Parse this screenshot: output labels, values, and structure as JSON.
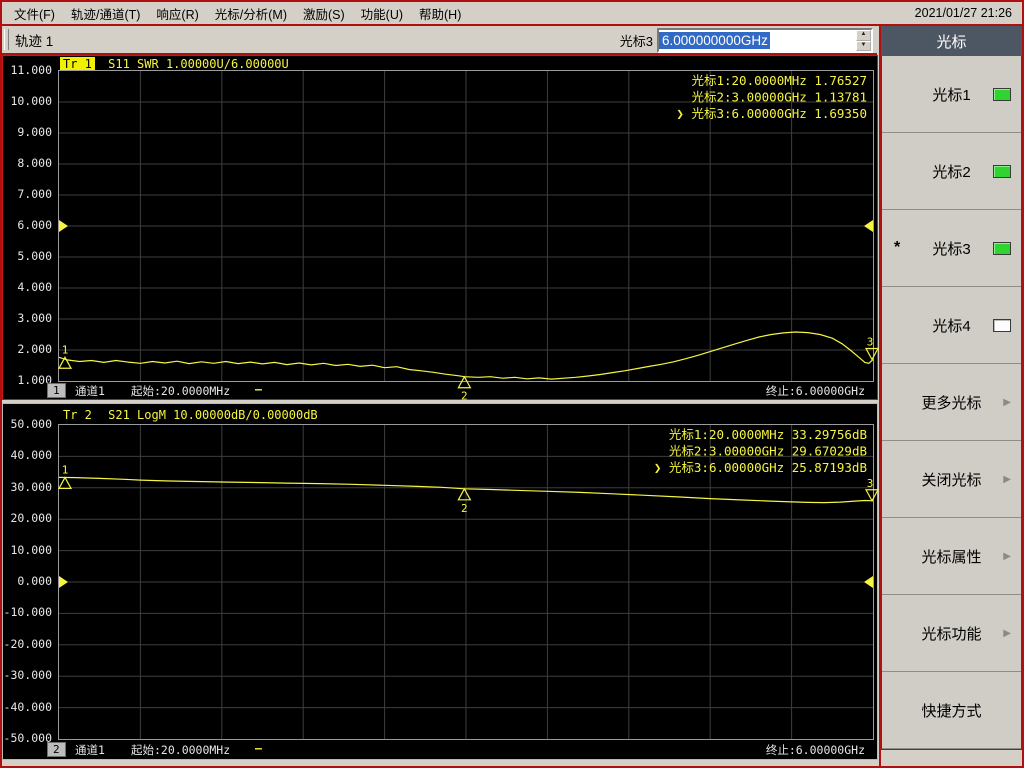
{
  "titlebar": {
    "menus": [
      {
        "id": "file",
        "label": "文件(F)"
      },
      {
        "id": "trace-channel",
        "label": "轨迹/通道(T)"
      },
      {
        "id": "response",
        "label": "响应(R)"
      },
      {
        "id": "marker-analysis",
        "label": "光标/分析(M)"
      },
      {
        "id": "stimulus",
        "label": "激励(S)"
      },
      {
        "id": "function",
        "label": "功能(U)"
      },
      {
        "id": "help",
        "label": "帮助(H)"
      }
    ],
    "datetime": "2021/01/27 21:26"
  },
  "toolbar": {
    "trace_label": "轨迹 1",
    "marker_name": "光标3",
    "marker_value": "6.000000000GHz"
  },
  "sidebar": {
    "title": "光标",
    "active_indicator": "*",
    "buttons": [
      {
        "id": "marker1",
        "label": "光标1",
        "led": "on",
        "active": false
      },
      {
        "id": "marker2",
        "label": "光标2",
        "led": "on",
        "active": false
      },
      {
        "id": "marker3",
        "label": "光标3",
        "led": "on",
        "active": true
      },
      {
        "id": "marker4",
        "label": "光标4",
        "led": "off",
        "active": false
      },
      {
        "id": "more-markers",
        "label": "更多光标",
        "arrow": true
      },
      {
        "id": "close-markers",
        "label": "关闭光标",
        "arrow": true
      },
      {
        "id": "marker-properties",
        "label": "光标属性",
        "arrow": true
      },
      {
        "id": "marker-functions",
        "label": "光标功能",
        "arrow": true
      },
      {
        "id": "shortcuts",
        "label": "快捷方式"
      }
    ]
  },
  "ui": {
    "active_prefix": "❯",
    "dash": "—"
  },
  "colors": {
    "trace": "#f5f542",
    "readout": "#f5f542",
    "grid": "#3e3e3e",
    "plot_border": "#9b9b9b",
    "led_on": "#2fd42f",
    "selection_blue": "#316ac5",
    "frame_red": "#b01010",
    "panel_header": "#4d5663"
  },
  "charts": [
    {
      "trace_badge": "Tr 1",
      "trace_active": true,
      "trace_info": "S11 SWR 1.00000U/6.00000U",
      "marker_readouts": [
        {
          "name": "光标1",
          "freq": "20.0000MHz",
          "value": "1.76527",
          "active": false
        },
        {
          "name": "光标2",
          "freq": "3.00000GHz",
          "value": "1.13781",
          "active": false
        },
        {
          "name": "光标3",
          "freq": "6.00000GHz",
          "value": "1.69350",
          "active": true
        }
      ],
      "channel_badge": "1",
      "channel": "通道1",
      "start": "起始:20.0000MHz",
      "dash": "—",
      "stop": "终止:6.00000GHz"
    },
    {
      "trace_badge": "Tr 2",
      "trace_active": false,
      "trace_info": "S21 LogM 10.00000dB/0.00000dB",
      "marker_readouts": [
        {
          "name": "光标1",
          "freq": "20.0000MHz",
          "value": "33.29756dB",
          "active": false
        },
        {
          "name": "光标2",
          "freq": "3.00000GHz",
          "value": "29.67029dB",
          "active": false
        },
        {
          "name": "光标3",
          "freq": "6.00000GHz",
          "value": "25.87193dB",
          "active": true
        }
      ],
      "channel_badge": "2",
      "channel": "通道1",
      "start": "起始:20.0000MHz",
      "dash": "—",
      "stop": "终止:6.00000GHz"
    }
  ],
  "chart_data": [
    {
      "type": "line",
      "title": "S11 SWR",
      "x_start": "20.0000MHz",
      "x_stop": "6.00000GHz",
      "ylim": [
        1,
        11
      ],
      "ystep": 1,
      "ref_value": 6.0,
      "grid": [
        10,
        10
      ],
      "series": [
        {
          "name": "S11 SWR",
          "points": [
            [
              0,
              1.765
            ],
            [
              0.01,
              1.68
            ],
            [
              0.025,
              1.63
            ],
            [
              0.04,
              1.66
            ],
            [
              0.055,
              1.6
            ],
            [
              0.07,
              1.66
            ],
            [
              0.085,
              1.61
            ],
            [
              0.1,
              1.57
            ],
            [
              0.115,
              1.63
            ],
            [
              0.13,
              1.58
            ],
            [
              0.145,
              1.64
            ],
            [
              0.16,
              1.56
            ],
            [
              0.175,
              1.62
            ],
            [
              0.19,
              1.57
            ],
            [
              0.205,
              1.63
            ],
            [
              0.22,
              1.56
            ],
            [
              0.235,
              1.61
            ],
            [
              0.25,
              1.55
            ],
            [
              0.265,
              1.6
            ],
            [
              0.28,
              1.53
            ],
            [
              0.295,
              1.58
            ],
            [
              0.31,
              1.52
            ],
            [
              0.325,
              1.57
            ],
            [
              0.34,
              1.5
            ],
            [
              0.355,
              1.54
            ],
            [
              0.37,
              1.47
            ],
            [
              0.385,
              1.51
            ],
            [
              0.4,
              1.43
            ],
            [
              0.415,
              1.46
            ],
            [
              0.43,
              1.37
            ],
            [
              0.445,
              1.33
            ],
            [
              0.46,
              1.28
            ],
            [
              0.475,
              1.22
            ],
            [
              0.49,
              1.17
            ],
            [
              0.498,
              1.138
            ],
            [
              0.515,
              1.12
            ],
            [
              0.53,
              1.14
            ],
            [
              0.545,
              1.09
            ],
            [
              0.56,
              1.12
            ],
            [
              0.575,
              1.07
            ],
            [
              0.59,
              1.1
            ],
            [
              0.605,
              1.06
            ],
            [
              0.62,
              1.09
            ],
            [
              0.635,
              1.12
            ],
            [
              0.65,
              1.16
            ],
            [
              0.665,
              1.21
            ],
            [
              0.68,
              1.27
            ],
            [
              0.695,
              1.33
            ],
            [
              0.71,
              1.4
            ],
            [
              0.725,
              1.47
            ],
            [
              0.74,
              1.54
            ],
            [
              0.755,
              1.62
            ],
            [
              0.77,
              1.72
            ],
            [
              0.785,
              1.83
            ],
            [
              0.8,
              1.95
            ],
            [
              0.815,
              2.07
            ],
            [
              0.83,
              2.19
            ],
            [
              0.845,
              2.31
            ],
            [
              0.86,
              2.42
            ],
            [
              0.875,
              2.5
            ],
            [
              0.89,
              2.55
            ],
            [
              0.905,
              2.58
            ],
            [
              0.92,
              2.56
            ],
            [
              0.935,
              2.5
            ],
            [
              0.95,
              2.38
            ],
            [
              0.962,
              2.2
            ],
            [
              0.972,
              2.0
            ],
            [
              0.982,
              1.78
            ],
            [
              0.99,
              1.6
            ],
            [
              0.995,
              1.57
            ],
            [
              1,
              1.6935
            ]
          ]
        }
      ],
      "markers": [
        {
          "n": "1",
          "x": 0,
          "y": 1.76527,
          "pos": "up"
        },
        {
          "n": "2",
          "x": 0.498,
          "y": 1.13781,
          "pos": "below"
        },
        {
          "n": "3",
          "x": 1,
          "y": 1.6935,
          "pos": "down"
        }
      ]
    },
    {
      "type": "line",
      "title": "S21 LogM",
      "x_start": "20.0000MHz",
      "x_stop": "6.00000GHz",
      "ylim": [
        -50,
        50
      ],
      "ystep": 10,
      "ref_value": 0.0,
      "grid": [
        10,
        10
      ],
      "series": [
        {
          "name": "S21 LogM",
          "points": [
            [
              0,
              33.3
            ],
            [
              0.02,
              33.25
            ],
            [
              0.05,
              33.0
            ],
            [
              0.08,
              32.7
            ],
            [
              0.1,
              32.45
            ],
            [
              0.13,
              32.2
            ],
            [
              0.16,
              32.05
            ],
            [
              0.2,
              31.85
            ],
            [
              0.24,
              31.7
            ],
            [
              0.28,
              31.5
            ],
            [
              0.32,
              31.35
            ],
            [
              0.36,
              31.1
            ],
            [
              0.4,
              30.8
            ],
            [
              0.44,
              30.45
            ],
            [
              0.47,
              30.15
            ],
            [
              0.498,
              29.67
            ],
            [
              0.53,
              29.45
            ],
            [
              0.56,
              29.2
            ],
            [
              0.6,
              28.9
            ],
            [
              0.64,
              28.55
            ],
            [
              0.68,
              28.1
            ],
            [
              0.72,
              27.6
            ],
            [
              0.76,
              27.1
            ],
            [
              0.8,
              26.55
            ],
            [
              0.84,
              26.1
            ],
            [
              0.87,
              25.8
            ],
            [
              0.9,
              25.5
            ],
            [
              0.92,
              25.35
            ],
            [
              0.94,
              25.3
            ],
            [
              0.96,
              25.45
            ],
            [
              0.98,
              25.8
            ],
            [
              0.99,
              25.95
            ],
            [
              1,
              25.87
            ]
          ]
        }
      ],
      "markers": [
        {
          "n": "1",
          "x": 0,
          "y": 33.29756,
          "pos": "up"
        },
        {
          "n": "2",
          "x": 0.498,
          "y": 29.67029,
          "pos": "below"
        },
        {
          "n": "3",
          "x": 1,
          "y": 25.87193,
          "pos": "down"
        }
      ]
    }
  ]
}
